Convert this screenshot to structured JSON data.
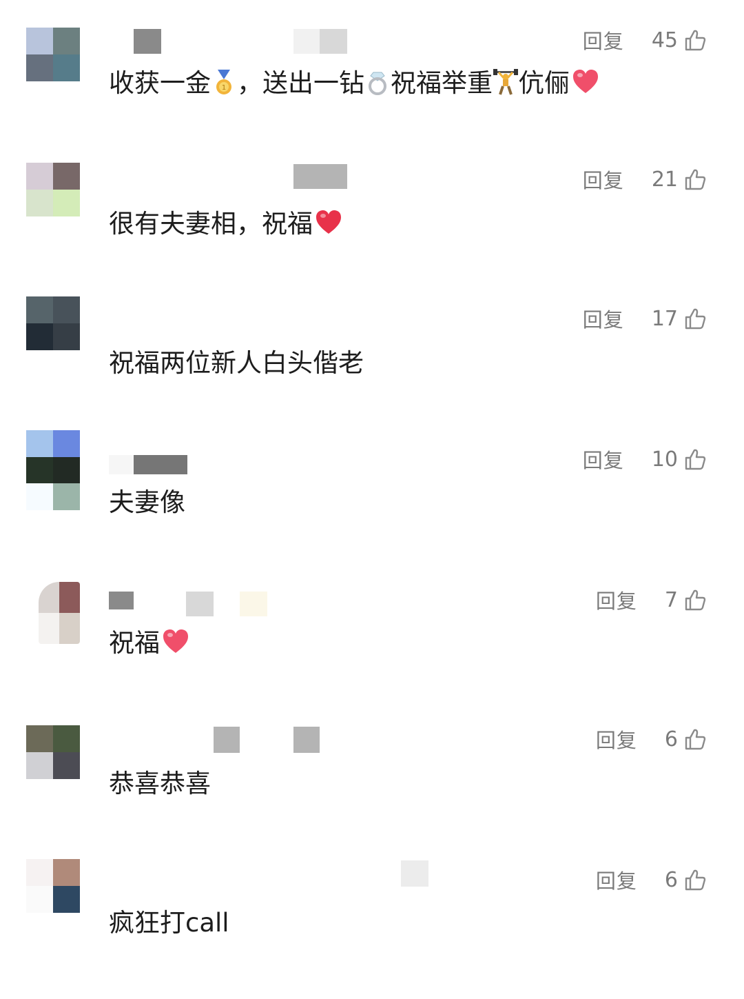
{
  "reply_label": "回复",
  "comments": [
    {
      "text_parts": [
        "收获一金",
        "，送出一钻",
        "祝福举重",
        "伉俪"
      ],
      "emojis": [
        "medal-icon",
        "ring-icon",
        "weightlifter-icon",
        "heart-icon"
      ],
      "likes": "45",
      "avatar_colors": [
        "#b8c4dc",
        "#6c8080",
        "#66707e",
        "#567c8a"
      ],
      "name_block_colors": [
        "#8a8a8a",
        "#f1f1f1",
        "#d8d8d8"
      ]
    },
    {
      "text_parts": [
        "很有夫妻相，祝福"
      ],
      "emojis": [
        "heart-icon"
      ],
      "likes": "21",
      "avatar_colors": [
        "#d6ccd6",
        "#786868",
        "#d8e4cc",
        "#d4ecb8"
      ],
      "name_block_colors": [
        "#b4b4b4"
      ]
    },
    {
      "text_parts": [
        "祝福两位新人白头偕老"
      ],
      "emojis": [],
      "likes": "17",
      "avatar_colors": [
        "#56646a",
        "#48525a",
        "#222c36",
        "#363e46"
      ],
      "name_block_colors": []
    },
    {
      "text_parts": [
        "夫妻像"
      ],
      "emojis": [],
      "likes": "10",
      "avatar_colors": [
        "#a4c4ec",
        "#6a88e0",
        "#263428",
        "#222a24",
        "#f6fbff",
        "#9bb5a9"
      ],
      "name_block_colors": [
        "#f6f6f6",
        "#767676"
      ]
    },
    {
      "text_parts": [
        "祝福"
      ],
      "emojis": [
        "heart-icon"
      ],
      "likes": "7",
      "avatar_colors": [
        "#d9d3d0",
        "#8c5a5a",
        "#f4f2f0",
        "#d8d0c8"
      ],
      "name_block_colors": [
        "#8a8a8a",
        "#d8d8d8",
        "#fbf7e8"
      ]
    },
    {
      "text_parts": [
        "恭喜恭喜"
      ],
      "emojis": [],
      "likes": "6",
      "avatar_colors": [
        "#6c6a58",
        "#4a5a40",
        "#d0d0d4",
        "#4c4c54"
      ],
      "name_block_colors": [
        "#b4b4b4",
        "#b4b4b4"
      ]
    },
    {
      "text_parts": [
        "疯狂打call"
      ],
      "emojis": [],
      "likes": "6",
      "avatar_colors": [
        "#f6f2f2",
        "#b08a7a",
        "#fafafa",
        "#2e4862"
      ],
      "name_block_colors": [
        "#ececec"
      ]
    }
  ]
}
